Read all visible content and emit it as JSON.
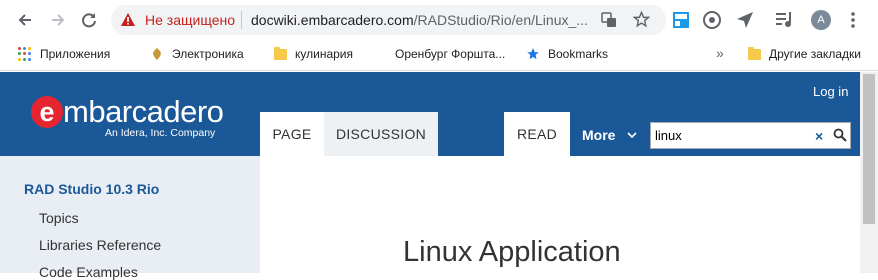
{
  "browser": {
    "security_label": "Не защищено",
    "url_host": "docwiki.embarcadero.com",
    "url_path": "/RADStudio/Rio/en/Linux_...",
    "profile_initial": "A"
  },
  "bookmarks": {
    "apps": "Приложения",
    "items": [
      "Электроника",
      "кулинария",
      "Оренбург Форшта...",
      "Bookmarks"
    ],
    "overflow": "»",
    "other": "Другие закладки"
  },
  "site": {
    "logo_letter": "e",
    "logo_rest": "mbarcadero",
    "logo_tagline": "An Idera, Inc. Company",
    "login": "Log in",
    "tabs": {
      "page": "PAGE",
      "discussion": "DISCUSSION",
      "read": "READ"
    },
    "more": "More",
    "search": {
      "value": "linux",
      "clear": "×"
    }
  },
  "sidebar": {
    "title": "RAD Studio 10.3 Rio",
    "links": [
      "Topics",
      "Libraries Reference",
      "Code Examples"
    ]
  },
  "content": {
    "title": "Linux Application"
  },
  "colors": {
    "header_bg": "#1b5897",
    "logo_red": "#e62531",
    "sidebar_bg": "#e8eef4",
    "insecure_red": "#c5221f"
  }
}
